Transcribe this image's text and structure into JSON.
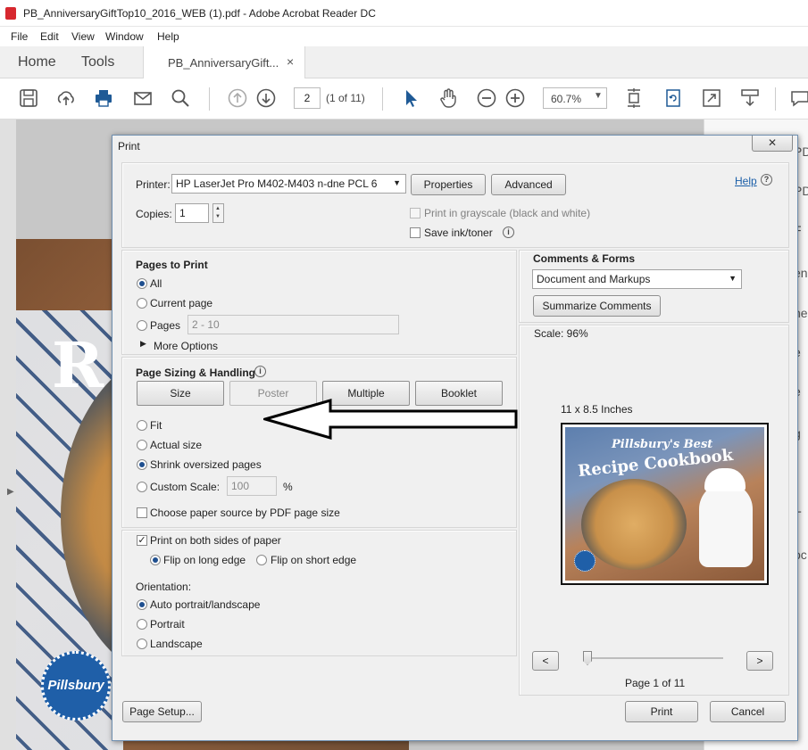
{
  "window": {
    "title": "PB_AnniversaryGiftTop10_2016_WEB (1).pdf - Adobe Acrobat Reader DC"
  },
  "menu": [
    "File",
    "Edit",
    "View",
    "Window",
    "Help"
  ],
  "tabs": {
    "home": "Home",
    "tools": "Tools",
    "document": "PB_AnniversaryGift...",
    "close": "×"
  },
  "toolbar": {
    "page_number": "2",
    "page_count": "(1 of 11)",
    "zoom": "60.7%",
    "icons": [
      "save-icon",
      "cloud-upload-icon",
      "print-icon",
      "email-icon",
      "search-icon",
      "page-up-icon",
      "page-down-icon",
      "select-pointer-icon",
      "hand-tool-icon",
      "zoom-out-icon",
      "zoom-in-icon",
      "fit-page-icon",
      "rotate-icon",
      "full-screen-icon",
      "read-mode-icon",
      "comment-icon"
    ]
  },
  "document_page": {
    "big_letter": "R",
    "logo_text": "Pillsbury"
  },
  "right_panel_fragments": [
    "PD",
    "PD",
    "F",
    "en",
    "ne",
    "e",
    "e",
    "g",
    "r",
    "T",
    "oc"
  ],
  "print_dialog": {
    "title": "Print",
    "close_label": "☒",
    "printer": {
      "label": "Printer:",
      "value": "HP LaserJet Pro M402-M403 n-dne PCL 6",
      "properties_button": "Properties",
      "advanced_button": "Advanced",
      "help_link": "Help"
    },
    "copies": {
      "label": "Copies:",
      "value": "1"
    },
    "grayscale_label": "Print in grayscale (black and white)",
    "save_ink_label": "Save ink/toner",
    "pages_to_print": {
      "heading": "Pages to Print",
      "all": "All",
      "current_page": "Current page",
      "pages": "Pages",
      "pages_value": "2 - 10",
      "more_options": "More Options"
    },
    "sizing": {
      "heading": "Page Sizing & Handling",
      "buttons": [
        "Size",
        "Poster",
        "Multiple",
        "Booklet"
      ],
      "fit": "Fit",
      "actual_size": "Actual size",
      "shrink": "Shrink oversized pages",
      "custom_scale": "Custom Scale:",
      "custom_scale_value": "100",
      "percent": "%",
      "paper_source": "Choose paper source by PDF page size"
    },
    "duplex": {
      "both_sides": "Print on both sides of paper",
      "long_edge": "Flip on long edge",
      "short_edge": "Flip on short edge"
    },
    "orientation": {
      "heading": "Orientation:",
      "auto": "Auto portrait/landscape",
      "portrait": "Portrait",
      "landscape": "Landscape"
    },
    "comments_forms": {
      "heading": "Comments & Forms",
      "value": "Document and Markups",
      "summarize_button": "Summarize Comments"
    },
    "preview": {
      "scale": "Scale:  96%",
      "paper_size": "11 x 8.5 Inches",
      "brand": "Pillsbury's Best",
      "title": "Recipe Cookbook",
      "prev": "<",
      "next": ">",
      "page_label": "Page 1 of 11"
    },
    "buttons": {
      "page_setup": "Page Setup...",
      "print": "Print",
      "cancel": "Cancel"
    }
  }
}
